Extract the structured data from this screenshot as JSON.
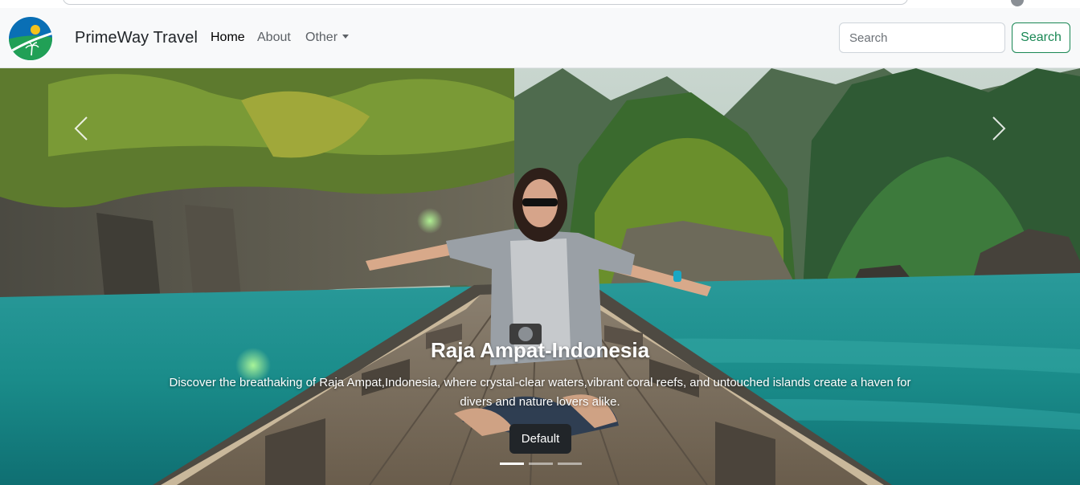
{
  "brand": {
    "name": "PrimeWay Travel",
    "logo_icon": "travel-globe-logo"
  },
  "nav": {
    "home_label": "Home",
    "about_label": "About",
    "other_label": "Other"
  },
  "search": {
    "placeholder": "Search",
    "button_label": "Search"
  },
  "colors": {
    "success": "#198754",
    "navbar_bg": "#f8f9fa",
    "dark_button": "#212529"
  },
  "carousel": {
    "slide_title": "Raja Ampat-Indonesia",
    "slide_text": "Discover the breathaking of Raja Ampat,Indonesia, where crystal-clear waters,vibrant coral reefs, and untouched islands create a haven for divers and nature lovers alike.",
    "button_label": "Default",
    "slide_count": 3,
    "active_index": 0,
    "prev_icon": "chevron-left-icon",
    "next_icon": "chevron-right-icon"
  }
}
